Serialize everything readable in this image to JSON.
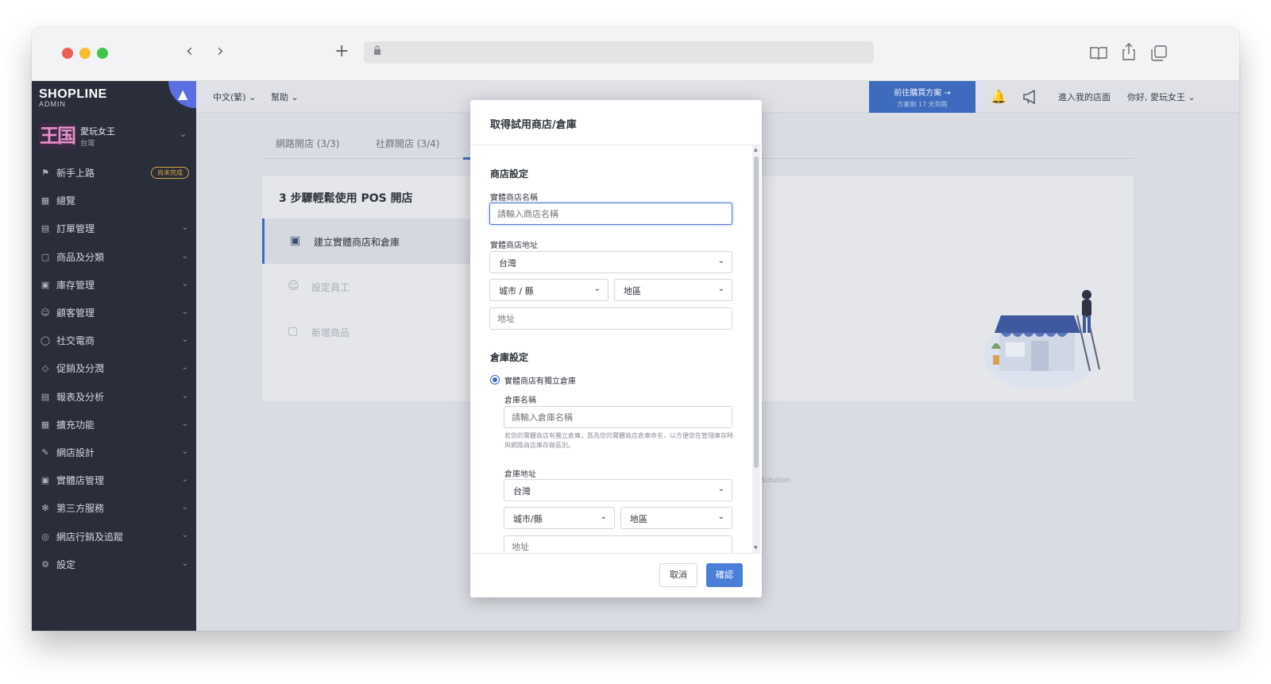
{
  "sidebar": {
    "logo_main": "SHOPLINE",
    "logo_sub": "ADMIN",
    "store_name": "愛玩女王",
    "store_region": "台灣",
    "avatar_text": "王国",
    "items": [
      {
        "label": "新手上路",
        "badge": "尚未完成"
      },
      {
        "label": "總覽"
      },
      {
        "label": "訂單管理"
      },
      {
        "label": "商品及分類"
      },
      {
        "label": "庫存管理"
      },
      {
        "label": "顧客管理"
      },
      {
        "label": "社交電商"
      },
      {
        "label": "促銷及分潤"
      },
      {
        "label": "報表及分析"
      },
      {
        "label": "擴充功能"
      },
      {
        "label": "網店設計"
      },
      {
        "label": "實體店管理"
      },
      {
        "label": "第三方服務"
      },
      {
        "label": "網店行銷及追蹤"
      },
      {
        "label": "設定"
      }
    ]
  },
  "topbar": {
    "language": "中文(繁)",
    "help": "幫助",
    "promo_title": "前往購買方案 →",
    "promo_sub": "方案剩 17 天到期",
    "enter_store": "進入我的店面",
    "greeting": "你好, 愛玩女王"
  },
  "main": {
    "tabs": [
      {
        "label": "網路開店 (3/3)"
      },
      {
        "label": "社群開店 (3/4)"
      }
    ],
    "card_title": "3 步驟輕鬆使用 POS 開店",
    "steps": [
      {
        "label": "建立實體商店和倉庫"
      },
      {
        "label": "設定員工"
      },
      {
        "label": "新增商品"
      }
    ],
    "footer_fragment": "Solution."
  },
  "modal": {
    "title": "取得試用商店/倉庫",
    "store_section": "商店設定",
    "store_name_label": "實體商店名稱",
    "store_name_placeholder": "請輸入商店名稱",
    "store_address_label": "實體商店地址",
    "country_value": "台灣",
    "city_value": "城市 / 縣",
    "district_value": "地區",
    "address_placeholder": "地址",
    "warehouse_section": "倉庫設定",
    "radio_label": "實體商店有獨立倉庫",
    "warehouse_name_label": "倉庫名稱",
    "warehouse_name_placeholder": "請輸入倉庫名稱",
    "warehouse_hint": "若您的實體商店有獨立倉庫，爲為您的實體商店倉庫命名，以方便您在管理庫存時與網路商店庫存做區別。",
    "warehouse_address_label": "倉庫地址",
    "wh_country_value": "台灣",
    "wh_city_value": "城市/縣",
    "wh_district_value": "地區",
    "wh_address_placeholder": "地址",
    "cancel_label": "取消",
    "confirm_label": "確認"
  },
  "colors": {
    "sidebar_bg": "#2a2e3b",
    "accent": "#3e6bbe",
    "confirm_button": "#4a7fd9",
    "badge": "#d8a63d"
  }
}
